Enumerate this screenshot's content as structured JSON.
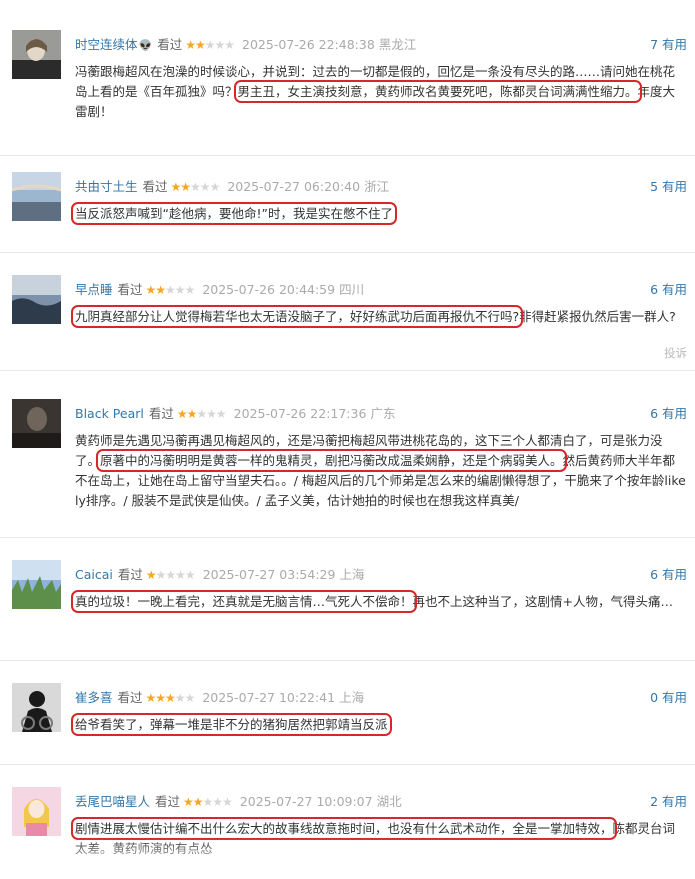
{
  "reviews": [
    {
      "user": "时空连续体",
      "badge": "◆",
      "status": "看过",
      "stars": 2,
      "time": "2025-07-26 22:48:38",
      "location": "黑龙江",
      "useful": "7 有用",
      "text_pre": "冯蘅跟梅超风在泡澡的时候谈心，并说到：过去的一切都是假的，回忆是一条没有尽头的路……请问她在桃花岛上看的是《百年孤独》吗？",
      "text_hl": "男主丑，女主演技刻意，黄药师改名黄要死吧，陈都灵台词满满性缩力。",
      "text_post": "年度大雷剧！",
      "avatar_colors": [
        "#8a8a88",
        "#2b2b2b",
        "#e3d7c8"
      ]
    },
    {
      "user": "共由寸土生",
      "status": "看过",
      "stars": 2,
      "time": "2025-07-27 06:20:40",
      "location": "浙江",
      "useful": "5 有用",
      "text_pre": "",
      "text_hl": "当反派怒声喊到“趁他病，要他命!”时，我是实在憋不住了",
      "text_post": "",
      "avatar_colors": [
        "#9db6cf",
        "#e6d8c6",
        "#5d6f80"
      ]
    },
    {
      "user": "早点睡",
      "status": "看过",
      "stars": 2,
      "time": "2025-07-26 20:44:59",
      "location": "四川",
      "useful": "6 有用",
      "text_pre": "",
      "text_hl": "九阴真经部分让人觉得梅若华也太无语没脑子了，好好练武功后面再报仇不行吗?",
      "text_post": "非得赶紧报仇然后害一群人?",
      "report": "投诉",
      "avatar_colors": [
        "#7d92aa",
        "#2e3b4a",
        "#c7d2dc"
      ]
    },
    {
      "user": "Black Pearl",
      "status": "看过",
      "stars": 2,
      "time": "2025-07-26 22:17:36",
      "location": "广东",
      "useful": "6 有用",
      "text_pre": "黄药师是先遇见冯蘅再遇见梅超风的，还是冯蘅把梅超风带进桃花岛的，这下三个人都清白了，可是张力没了。",
      "text_hl": "原著中的冯蘅明明是黄蓉一样的鬼精灵，剧把冯蘅改成温柔娴静，还是个病弱美人。",
      "text_post": "然后黄药师大半年都不在岛上，让她在岛上留守当望夫石。。/ 梅超风后的几个师弟是怎么来的编剧懒得想了，干脆来了个按年龄likely排序。/ 服装不是武侠是仙侠。/ 孟子义美，估计她拍的时候也在想我这样真美/",
      "avatar_colors": [
        "#3a3530",
        "#6f655a",
        "#1e1b18"
      ]
    },
    {
      "user": "Caicai",
      "status": "看过",
      "stars": 1,
      "time": "2025-07-27 03:54:29",
      "location": "上海",
      "useful": "6 有用",
      "text_pre": "",
      "text_hl": "真的垃圾！一晚上看完，还真就是无脑言情…气死人不偿命！",
      "text_post": "再也不上这种当了，这剧情+人物，气得头痛…",
      "avatar_colors": [
        "#8fb3dc",
        "#5d8f4a",
        "#cfe0f0"
      ]
    },
    {
      "user": "崔多喜",
      "status": "看过",
      "stars": 3,
      "time": "2025-07-27 10:22:41",
      "location": "上海",
      "useful": "0 有用",
      "text_pre": "",
      "text_hl": "给爷看笑了，弹幕一堆是非不分的猪狗居然把郭靖当反派",
      "text_post": "",
      "avatar_colors": [
        "#d9d9d9",
        "#1a1a1a",
        "#7a7a7a"
      ]
    },
    {
      "user": "丢尾巴喵星人",
      "status": "看过",
      "stars": 2,
      "time": "2025-07-27 10:09:07",
      "location": "湖北",
      "useful": "2 有用",
      "text_pre": "",
      "text_hl": "剧情进展太慢估计编不出什么宏大的故事线故意拖时间，也没有什么武术动作，全是一掌加特效，",
      "text_post": "陈都灵台词太差。黄药师演的有点怂",
      "avatar_colors": [
        "#f4d7e3",
        "#f2c84b",
        "#e88aa8"
      ]
    }
  ]
}
